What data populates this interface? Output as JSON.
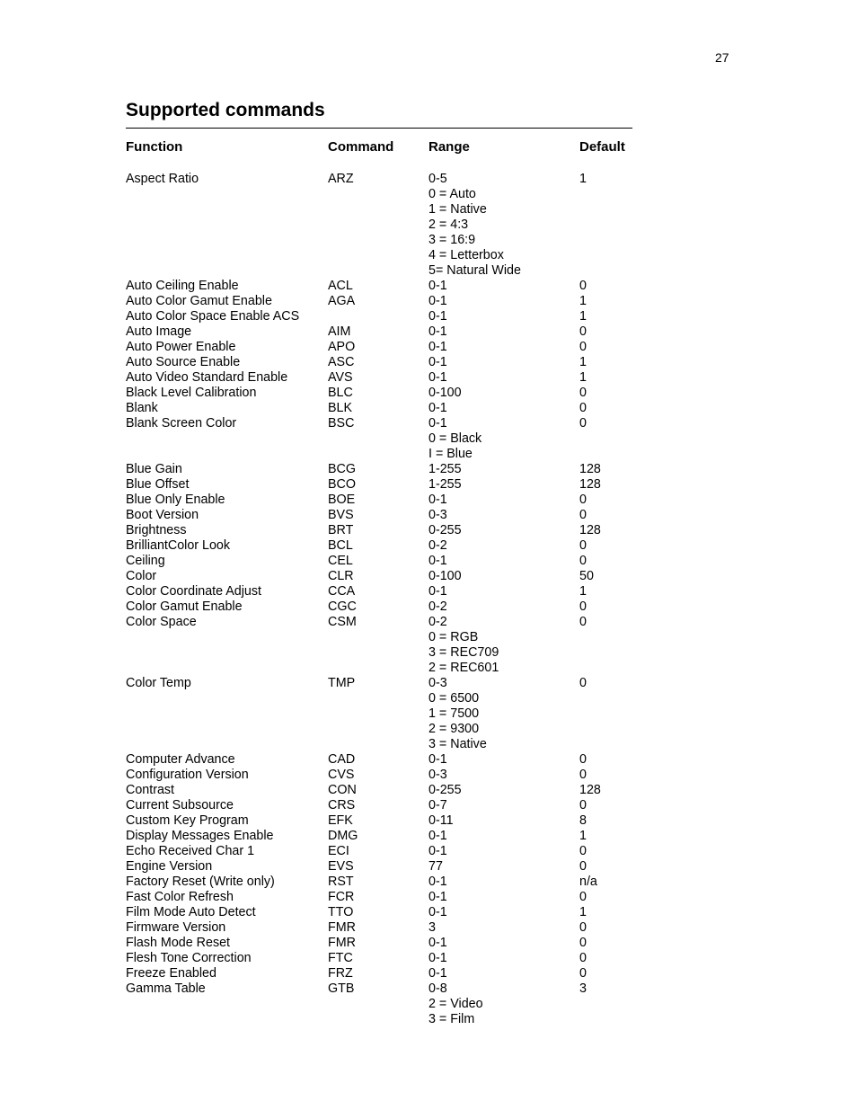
{
  "page": {
    "number": "27",
    "title": "Supported commands"
  },
  "table": {
    "headers": {
      "function": "Function",
      "command": "Command",
      "range": "Range",
      "default": "Default"
    },
    "rows": [
      {
        "function": "Aspect Ratio",
        "command": "ARZ",
        "range": [
          "0-5",
          "0 = Auto",
          "1 = Native",
          "2 = 4:3",
          "3 = 16:9",
          "4 = Letterbox",
          "5= Natural Wide"
        ],
        "default": "1"
      },
      {
        "function": "Auto Ceiling Enable",
        "command": "ACL",
        "range": [
          "0-1"
        ],
        "default": "0"
      },
      {
        "function": "Auto Color Gamut Enable",
        "command": "AGA",
        "range": [
          "0-1"
        ],
        "default": "1"
      },
      {
        "function": "Auto Color Space Enable ACS",
        "command": "",
        "range": [
          "0-1"
        ],
        "default": "1"
      },
      {
        "function": "Auto Image",
        "command": "AIM",
        "range": [
          "0-1"
        ],
        "default": "0"
      },
      {
        "function": "Auto Power Enable",
        "command": "APO",
        "range": [
          "0-1"
        ],
        "default": "0"
      },
      {
        "function": "Auto Source Enable",
        "command": "ASC",
        "range": [
          "0-1"
        ],
        "default": "1"
      },
      {
        "function": "Auto Video Standard Enable",
        "command": "AVS",
        "range": [
          "0-1"
        ],
        "default": "1"
      },
      {
        "function": "Black Level Calibration",
        "command": "BLC",
        "range": [
          "0-100"
        ],
        "default": "0"
      },
      {
        "function": "Blank",
        "command": "BLK",
        "range": [
          "0-1"
        ],
        "default": "0"
      },
      {
        "function": "Blank Screen Color",
        "command": "BSC",
        "range": [
          "0-1",
          "0 = Black",
          "I  = Blue"
        ],
        "default": "0"
      },
      {
        "function": "Blue Gain",
        "command": "BCG",
        "range": [
          "1-255"
        ],
        "default": "128"
      },
      {
        "function": "Blue Offset",
        "command": "BCO",
        "range": [
          "1-255"
        ],
        "default": "128"
      },
      {
        "function": "Blue Only Enable",
        "command": "BOE",
        "range": [
          "0-1"
        ],
        "default": "0"
      },
      {
        "function": "Boot Version",
        "command": "BVS",
        "range": [
          "0-3"
        ],
        "default": "0"
      },
      {
        "function": "Brightness",
        "command": "BRT",
        "range": [
          "0-255"
        ],
        "default": "128"
      },
      {
        "function": "BrilliantColor Look",
        "command": "BCL",
        "range": [
          "0-2"
        ],
        "default": "0"
      },
      {
        "function": "Ceiling",
        "command": "CEL",
        "range": [
          "0-1"
        ],
        "default": "0"
      },
      {
        "function": "Color",
        "command": "CLR",
        "range": [
          "0-100"
        ],
        "default": "50"
      },
      {
        "function": "Color Coordinate Adjust",
        "command": "CCA",
        "range": [
          "0-1"
        ],
        "default": "1"
      },
      {
        "function": "Color Gamut Enable",
        "command": "CGC",
        "range": [
          "0-2"
        ],
        "default": "0"
      },
      {
        "function": "Color Space",
        "command": "CSM",
        "range": [
          "0-2",
          "0 = RGB",
          "3 = REC709",
          "2 = REC601"
        ],
        "default": "0"
      },
      {
        "function": "Color Temp",
        "command": "TMP",
        "range": [
          "0-3",
          "0 = 6500",
          "1 = 7500",
          "2 = 9300",
          "3 = Native"
        ],
        "default": "0"
      },
      {
        "function": "Computer Advance",
        "command": "CAD",
        "range": [
          "0-1"
        ],
        "default": "0"
      },
      {
        "function": "Configuration Version",
        "command": "CVS",
        "range": [
          "0-3"
        ],
        "default": "0"
      },
      {
        "function": "Contrast",
        "command": "CON",
        "range": [
          "0-255"
        ],
        "default": "128"
      },
      {
        "function": "Current Subsource",
        "command": "CRS",
        "range": [
          "0-7"
        ],
        "default": "0"
      },
      {
        "function": "Custom Key Program",
        "command": "EFK",
        "range": [
          "0-11"
        ],
        "default": "8"
      },
      {
        "function": "Display Messages Enable",
        "command": "DMG",
        "range": [
          "0-1"
        ],
        "default": "1"
      },
      {
        "function": "Echo Received Char 1",
        "command": "ECI",
        "range": [
          "0-1"
        ],
        "default": "0"
      },
      {
        "function": "Engine Version",
        "command": "EVS",
        "range": [
          "77"
        ],
        "default": "0"
      },
      {
        "function": "Factory Reset (Write only)",
        "command": "RST",
        "range": [
          "0-1"
        ],
        "default": "n/a"
      },
      {
        "function": "Fast Color Refresh",
        "command": "FCR",
        "range": [
          "0-1"
        ],
        "default": "0"
      },
      {
        "function": "Film Mode Auto Detect",
        "command": "TTO",
        "range": [
          "0-1"
        ],
        "default": "1"
      },
      {
        "function": "Firmware Version",
        "command": "FMR",
        "range": [
          "3"
        ],
        "default": "0"
      },
      {
        "function": "Flash Mode Reset",
        "command": "FMR",
        "range": [
          "0-1"
        ],
        "default": "0"
      },
      {
        "function": "Flesh Tone Correction",
        "command": "FTC",
        "range": [
          "0-1"
        ],
        "default": "0"
      },
      {
        "function": "Freeze Enabled",
        "command": "FRZ",
        "range": [
          "0-1"
        ],
        "default": "0"
      },
      {
        "function": "Gamma Table",
        "command": "GTB",
        "range": [
          "0-8",
          "2 = Video",
          "3 = Film"
        ],
        "default": "3"
      }
    ]
  }
}
